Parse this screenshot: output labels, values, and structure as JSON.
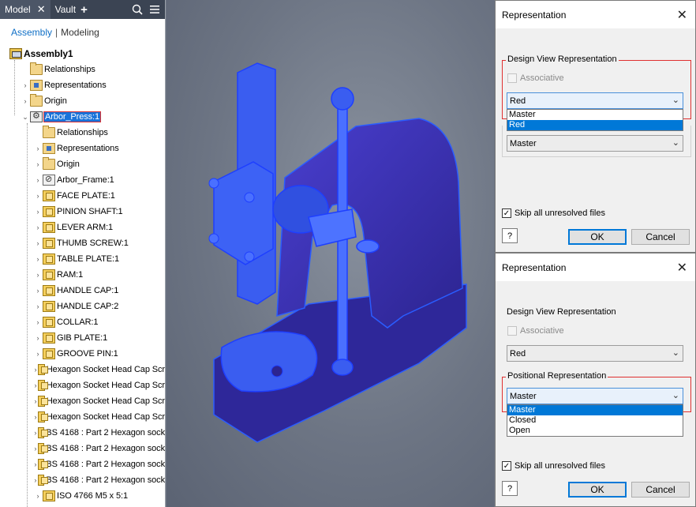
{
  "browser": {
    "tabs": [
      {
        "label": "Model",
        "close": "✕"
      },
      {
        "label": "Vault",
        "plus": "+"
      }
    ],
    "modes": {
      "assembly": "Assembly",
      "separator": "|",
      "modeling": "Modeling"
    },
    "tree": [
      {
        "label": "Assembly1",
        "icon": "assembly-icon",
        "level": 0,
        "arrow": "",
        "bold": true
      },
      {
        "label": "Relationships",
        "icon": "folder-icon",
        "level": 1,
        "arrow": ""
      },
      {
        "label": "Representations",
        "icon": "representations-icon",
        "level": 1,
        "arrow": "›"
      },
      {
        "label": "Origin",
        "icon": "folder-icon",
        "level": 1,
        "arrow": "›"
      },
      {
        "label": "Arbor_Press:1",
        "icon": "subassembly-icon",
        "level": 1,
        "arrow": "⌄",
        "selected": true
      },
      {
        "label": "Relationships",
        "icon": "folder-icon",
        "level": 2,
        "arrow": ""
      },
      {
        "label": "Representations",
        "icon": "representations-icon",
        "level": 2,
        "arrow": "›"
      },
      {
        "label": "Origin",
        "icon": "folder-icon",
        "level": 2,
        "arrow": "›"
      },
      {
        "label": "Arbor_Frame:1",
        "icon": "frame-icon",
        "level": 2,
        "arrow": "›"
      },
      {
        "label": "FACE PLATE:1",
        "icon": "part-icon",
        "level": 2,
        "arrow": "›"
      },
      {
        "label": "PINION SHAFT:1",
        "icon": "part-icon",
        "level": 2,
        "arrow": "›"
      },
      {
        "label": "LEVER ARM:1",
        "icon": "part-icon",
        "level": 2,
        "arrow": "›"
      },
      {
        "label": "THUMB SCREW:1",
        "icon": "part-icon",
        "level": 2,
        "arrow": "›"
      },
      {
        "label": "TABLE PLATE:1",
        "icon": "part-icon",
        "level": 2,
        "arrow": "›"
      },
      {
        "label": "RAM:1",
        "icon": "part-icon",
        "level": 2,
        "arrow": "›"
      },
      {
        "label": "HANDLE CAP:1",
        "icon": "part-icon",
        "level": 2,
        "arrow": "›"
      },
      {
        "label": "HANDLE CAP:2",
        "icon": "part-icon",
        "level": 2,
        "arrow": "›"
      },
      {
        "label": "COLLAR:1",
        "icon": "part-icon",
        "level": 2,
        "arrow": "›"
      },
      {
        "label": "GIB PLATE:1",
        "icon": "part-icon",
        "level": 2,
        "arrow": "›"
      },
      {
        "label": "GROOVE PIN:1",
        "icon": "part-icon",
        "level": 2,
        "arrow": "›"
      },
      {
        "label": "Hexagon Socket Head Cap Scr",
        "icon": "part-icon",
        "level": 2,
        "arrow": "›"
      },
      {
        "label": "Hexagon Socket Head Cap Scr",
        "icon": "part-icon",
        "level": 2,
        "arrow": "›"
      },
      {
        "label": "Hexagon Socket Head Cap Scr",
        "icon": "part-icon",
        "level": 2,
        "arrow": "›"
      },
      {
        "label": "Hexagon Socket Head Cap Scr",
        "icon": "part-icon",
        "level": 2,
        "arrow": "›"
      },
      {
        "label": "BS 4168 : Part 2 Hexagon sock",
        "icon": "part-icon",
        "level": 2,
        "arrow": "›"
      },
      {
        "label": "BS 4168 : Part 2 Hexagon sock",
        "icon": "part-icon",
        "level": 2,
        "arrow": "›"
      },
      {
        "label": "BS 4168 : Part 2 Hexagon sock",
        "icon": "part-icon",
        "level": 2,
        "arrow": "›"
      },
      {
        "label": "BS 4168 : Part 2 Hexagon sock",
        "icon": "part-icon",
        "level": 2,
        "arrow": "›"
      },
      {
        "label": "ISO 4766 M5 x 5:1",
        "icon": "part-icon",
        "level": 2,
        "arrow": "›"
      }
    ]
  },
  "dialog1": {
    "title": "Representation",
    "close": "✕",
    "design_group": "Design View Representation",
    "associative": "Associative",
    "design_value": "Red",
    "design_options": [
      {
        "label": "Master",
        "highlighted": false
      },
      {
        "label": "Red",
        "highlighted": true
      }
    ],
    "positional_value": "Master",
    "skip_label": "Skip all unresolved files",
    "skip_mark": "✓",
    "help": "?",
    "ok": "OK",
    "cancel": "Cancel"
  },
  "dialog2": {
    "title": "Representation",
    "close": "✕",
    "design_group": "Design View Representation",
    "associative": "Associative",
    "design_value": "Red",
    "positional_group": "Positional Representation",
    "positional_value": "Master",
    "positional_options": [
      {
        "label": "Master",
        "highlighted": true
      },
      {
        "label": "Closed",
        "highlighted": false
      },
      {
        "label": "Open",
        "highlighted": false
      }
    ],
    "skip_label": "Skip all unresolved files",
    "skip_mark": "✓",
    "help": "?",
    "ok": "OK",
    "cancel": "Cancel"
  },
  "colors": {
    "model_fill": "#3b2fb0",
    "model_edge": "#2a5cff",
    "selection": "#1a73d9",
    "highlight": "#0078d7",
    "group_red": "#e03030"
  },
  "icons": {
    "close": "close-icon",
    "plus": "plus-icon",
    "search": "search-icon",
    "menu": "hamburger-menu-icon",
    "chevron": "chevron-down-icon",
    "help": "help-icon"
  }
}
